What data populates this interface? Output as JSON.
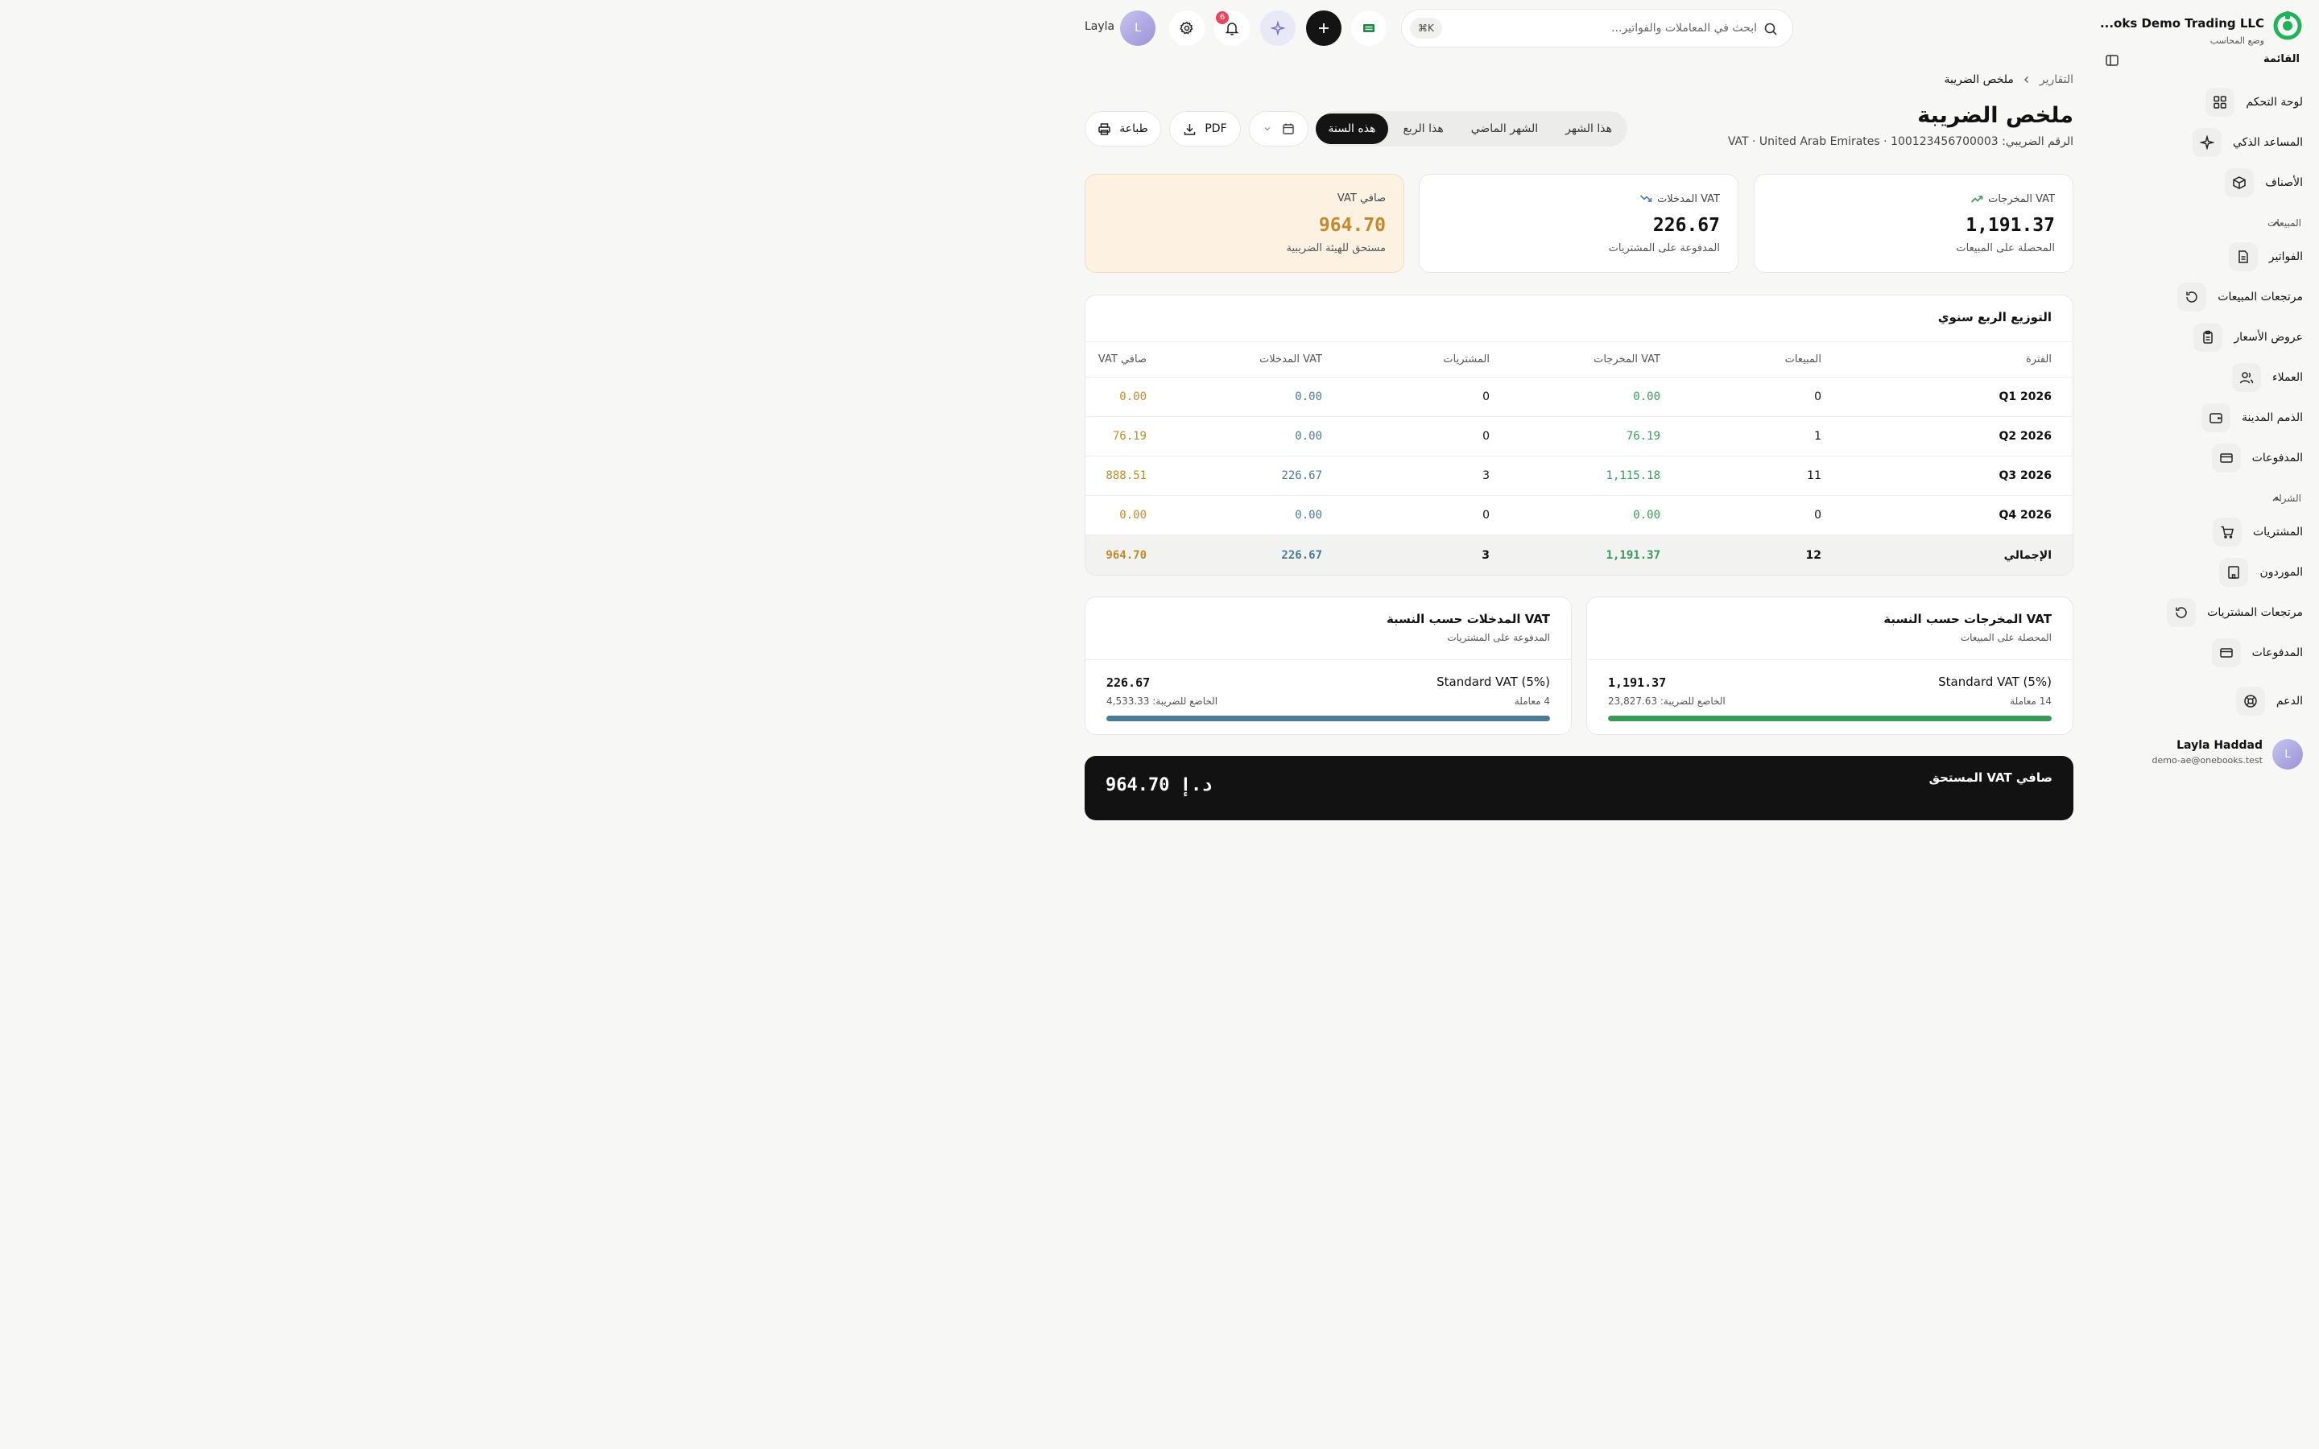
{
  "sidebar": {
    "brand_name": "...oks Demo Trading LLC",
    "brand_sub": "وضع المحاسب",
    "menu_head": "القائمة",
    "items_top": [
      {
        "label": "لوحة التحكم",
        "icon": "grid-icon"
      },
      {
        "label": "المساعد الذكي",
        "icon": "sparkles-icon"
      },
      {
        "label": "الأصناف",
        "icon": "box-icon"
      }
    ],
    "section_sales": "المبيعات",
    "items_sales": [
      {
        "label": "الفواتير",
        "icon": "document-icon"
      },
      {
        "label": "مرتجعات المبيعات",
        "icon": "undo-icon"
      },
      {
        "label": "عروض الأسعار",
        "icon": "clipboard-icon"
      },
      {
        "label": "العملاء",
        "icon": "users-icon"
      },
      {
        "label": "الذمم المدينة",
        "icon": "wallet-icon"
      },
      {
        "label": "المدفوعات",
        "icon": "card-icon"
      }
    ],
    "section_purchase": "الشراء",
    "items_purchase": [
      {
        "label": "المشتريات",
        "icon": "cart-icon"
      },
      {
        "label": "الموردون",
        "icon": "building-icon"
      },
      {
        "label": "مرتجعات المشتريات",
        "icon": "undo-icon"
      },
      {
        "label": "المدفوعات",
        "icon": "card-icon"
      }
    ],
    "support": "الدعم",
    "user": {
      "name": "Layla Haddad",
      "email": "demo-ae@onebooks.test",
      "initial": "L"
    }
  },
  "topbar": {
    "search_placeholder": "ابحث في المعاملات والفواتير...",
    "shortcut": "⌘K",
    "notif_count": "6",
    "user_name": "Layla",
    "user_initial": "L"
  },
  "header": {
    "breadcrumb_parent": "التقارير",
    "breadcrumb_current": "ملخص الضريبة",
    "title": "ملخص الضريبة",
    "subtitle": "VAT · United Arab Emirates · الرقم الضريبي: 100123456700003"
  },
  "periods": {
    "options": [
      "هذا الشهر",
      "الشهر الماضي",
      "هذا الربع",
      "هذه السنة"
    ],
    "selected": "هذه السنة"
  },
  "actions": {
    "pdf": "PDF",
    "print": "طباعة"
  },
  "kpis": {
    "output": {
      "label": "VAT المخرجات",
      "value": "1,191.37",
      "note": "المحصلة على المبيعات"
    },
    "input": {
      "label": "VAT المدخلات",
      "value": "226.67",
      "note": "المدفوعة على المشتريات"
    },
    "net": {
      "label": "صافي VAT",
      "value": "964.70",
      "note": "مستحق للهيئة الضريبية"
    }
  },
  "quarterly": {
    "title": "التوزيع الربع سنوي",
    "columns": [
      "الفترة",
      "المبيعات",
      "VAT المخرجات",
      "المشتريات",
      "VAT المدخلات",
      "صافي VAT"
    ],
    "rows": [
      {
        "period": "Q1 2026",
        "sales": "0",
        "output_vat": "0.00",
        "purchases": "0",
        "input_vat": "0.00",
        "net_vat": "0.00"
      },
      {
        "period": "Q2 2026",
        "sales": "1",
        "output_vat": "76.19",
        "purchases": "0",
        "input_vat": "0.00",
        "net_vat": "76.19"
      },
      {
        "period": "Q3 2026",
        "sales": "11",
        "output_vat": "1,115.18",
        "purchases": "3",
        "input_vat": "226.67",
        "net_vat": "888.51"
      },
      {
        "period": "Q4 2026",
        "sales": "0",
        "output_vat": "0.00",
        "purchases": "0",
        "input_vat": "0.00",
        "net_vat": "0.00"
      }
    ],
    "total": {
      "period": "الإجمالي",
      "sales": "12",
      "output_vat": "1,191.37",
      "purchases": "3",
      "input_vat": "226.67",
      "net_vat": "964.70"
    }
  },
  "rates": {
    "output": {
      "title": "VAT المخرجات حسب النسبة",
      "subtitle": "المحصلة على المبيعات",
      "rate_name": "Standard VAT (5%)",
      "count": "14 معاملة",
      "amount": "1,191.37",
      "taxable": "الخاضع للضريبة: 23,827.63",
      "fill_fraction": 1.0,
      "color": "#3a9a5b"
    },
    "input": {
      "title": "VAT المدخلات حسب النسبة",
      "subtitle": "المدفوعة على المشتريات",
      "rate_name": "Standard VAT (5%)",
      "count": "4 معاملة",
      "amount": "226.67",
      "taxable": "الخاضع للضريبة: 4,533.33",
      "fill_fraction": 1.0,
      "color": "#4b7b96"
    }
  },
  "net_due": {
    "title": "صافي VAT المستحق",
    "value": "964.70 د.إ"
  },
  "colors": {
    "accent_green": "#3a9a5b",
    "accent_blue": "#4b7b96",
    "accent_amber": "#c4892a",
    "brand_green": "#1fb35a"
  }
}
